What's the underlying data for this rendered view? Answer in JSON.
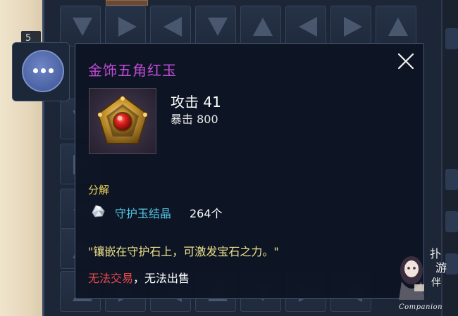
{
  "inventory": {
    "slot_count_badge": "5"
  },
  "more_button": {
    "icon": "ellipsis-icon"
  },
  "tooltip": {
    "title": "金饰五角红玉",
    "title_color": "#c24ad8",
    "close_icon": "close-icon",
    "item_icon": "gold-pentagon-ruby-gem-icon",
    "stats": {
      "main": "攻击 41",
      "sub": "暴击 800"
    },
    "disassemble": {
      "label": "分解",
      "material_icon": "crystal-icon",
      "material_name": "守护玉结晶",
      "material_count": "264个"
    },
    "description": "\"镶嵌在守护石上，可激发宝石之力。\"",
    "restrictions": {
      "no_trade": "无法交易",
      "separator": "，",
      "no_sell": "无法出售",
      "no_trade_color": "#e84a4a"
    }
  },
  "watermark": {
    "text": "Companion"
  }
}
